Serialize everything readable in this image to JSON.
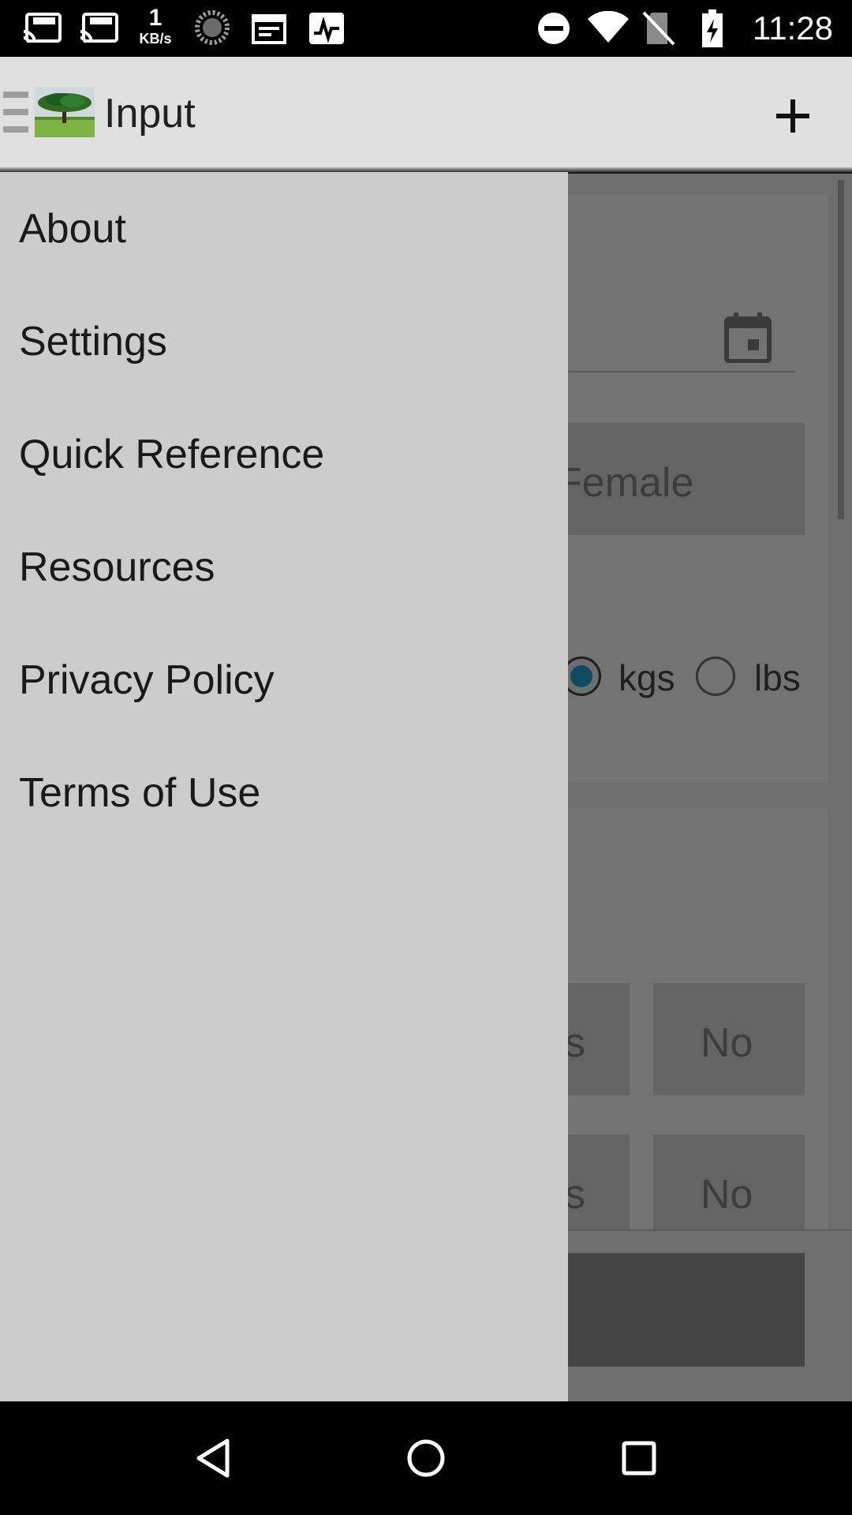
{
  "status_bar": {
    "time": "11:28",
    "net_speed_value": "1",
    "net_speed_unit": "KB/s",
    "icons": [
      "cast-http-icon",
      "cast-http-icon",
      "sync-icon",
      "calendar-icon",
      "activity-icon",
      "dnd-icon",
      "wifi-icon",
      "no-sim-icon",
      "battery-charging-icon"
    ]
  },
  "app_bar": {
    "title": "Input",
    "menu_icon": "hamburger-icon",
    "logo_icon": "tree-logo-icon",
    "action_icon": "plus-icon"
  },
  "drawer": {
    "items": [
      {
        "label": "About"
      },
      {
        "label": "Settings"
      },
      {
        "label": "Quick Reference"
      },
      {
        "label": "Resources"
      },
      {
        "label": "Privacy Policy"
      },
      {
        "label": "Terms of Use"
      }
    ]
  },
  "background": {
    "sex_option": "Female",
    "weight_units": [
      {
        "label": "kgs",
        "selected": true
      },
      {
        "label": "lbs",
        "selected": false
      }
    ],
    "yes_no_rows": [
      {
        "yes": "s",
        "no": "No"
      },
      {
        "yes": "s",
        "no": "No"
      }
    ],
    "calendar_icon": "calendar-icon"
  },
  "nav_bar": {
    "icons": [
      "back-icon",
      "home-icon",
      "recents-icon"
    ]
  },
  "colors": {
    "app_bar": "#e0e0e0",
    "drawer": "#cccccc",
    "scrim": "#6e6e6e",
    "radio_accent": "#0e4b5e"
  }
}
